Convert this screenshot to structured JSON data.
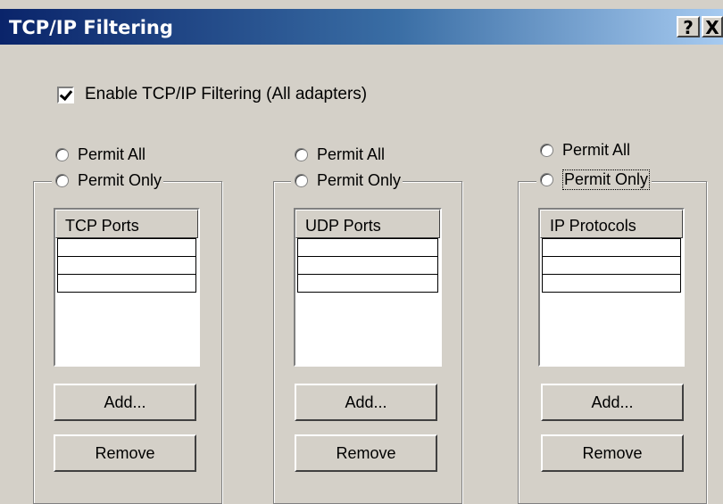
{
  "window": {
    "title": "TCP/IP Filtering",
    "help_label": "?",
    "close_label": "X"
  },
  "enable": {
    "label": "Enable TCP/IP Filtering (All adapters)",
    "checked": true
  },
  "columns": [
    {
      "permit_all": "Permit All",
      "permit_only": "Permit Only",
      "list_header": "TCP Ports",
      "add_label": "Add...",
      "remove_label": "Remove"
    },
    {
      "permit_all": "Permit All",
      "permit_only": "Permit Only",
      "list_header": "UDP Ports",
      "add_label": "Add...",
      "remove_label": "Remove"
    },
    {
      "permit_all": "Permit All",
      "permit_only": "Permit Only",
      "list_header": "IP Protocols",
      "add_label": "Add...",
      "remove_label": "Remove"
    }
  ]
}
